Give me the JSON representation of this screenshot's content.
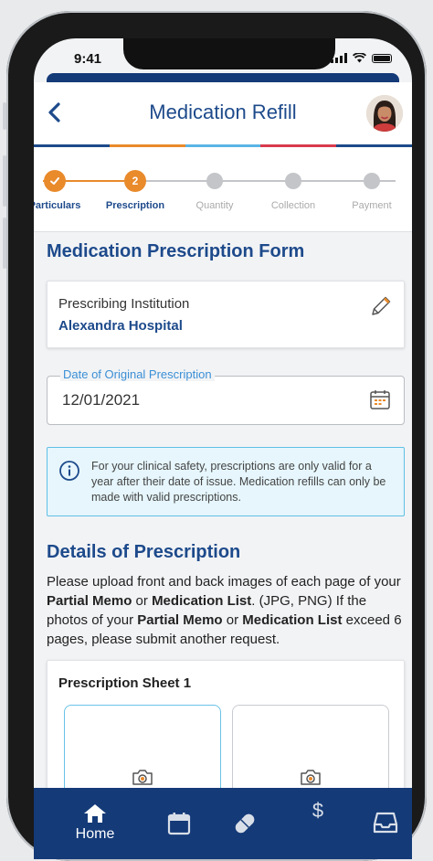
{
  "status_bar": {
    "time": "9:41"
  },
  "header": {
    "title": "Medication Refill",
    "back_icon": "chevron-left-icon",
    "avatar_icon": "user-avatar"
  },
  "accent_colors": {
    "primary": "#1d4a8b",
    "step": "#e98a2b",
    "info_border": "#5fc0e6",
    "nav": "#143a78"
  },
  "stepper": {
    "steps": [
      {
        "label": "Particulars",
        "state": "done"
      },
      {
        "label": "Prescription",
        "state": "active",
        "number": "2"
      },
      {
        "label": "Quantity",
        "state": "todo"
      },
      {
        "label": "Collection",
        "state": "todo"
      },
      {
        "label": "Payment",
        "state": "todo"
      }
    ]
  },
  "form": {
    "title": "Medication Prescription Form",
    "institution": {
      "label": "Prescribing Institution",
      "value": "Alexandra Hospital",
      "edit_icon": "pencil-icon"
    },
    "date_field": {
      "label": "Date of Original Prescription",
      "value": "12/01/2021",
      "icon": "calendar-icon"
    },
    "info": {
      "icon": "info-icon",
      "text": "For your clinical safety, prescriptions are only valid for a year after their date of issue. Medication refills can only be made with valid prescriptions."
    }
  },
  "details": {
    "title": "Details of Prescription",
    "para_1": "Please upload front and back images of each page of your ",
    "bold_1": "Partial Memo",
    "para_2": " or ",
    "bold_2": "Medication List",
    "para_3": ". (JPG, PNG) If the photos of your ",
    "bold_3": "Partial Memo",
    "para_4": " or ",
    "bold_4": "Medication List",
    "para_5": " exceed 6 pages, please submit another request.",
    "sheet_title": "Prescription Sheet 1",
    "upload_icon": "camera-icon"
  },
  "tabbar": {
    "items": [
      {
        "label": "Home",
        "icon": "home-icon"
      },
      {
        "label": "",
        "icon": "calendar-icon"
      },
      {
        "label": "",
        "icon": "pill-icon"
      },
      {
        "label": "",
        "icon": "dollar-icon",
        "glyph": "$"
      },
      {
        "label": "",
        "icon": "inbox-icon"
      }
    ]
  }
}
